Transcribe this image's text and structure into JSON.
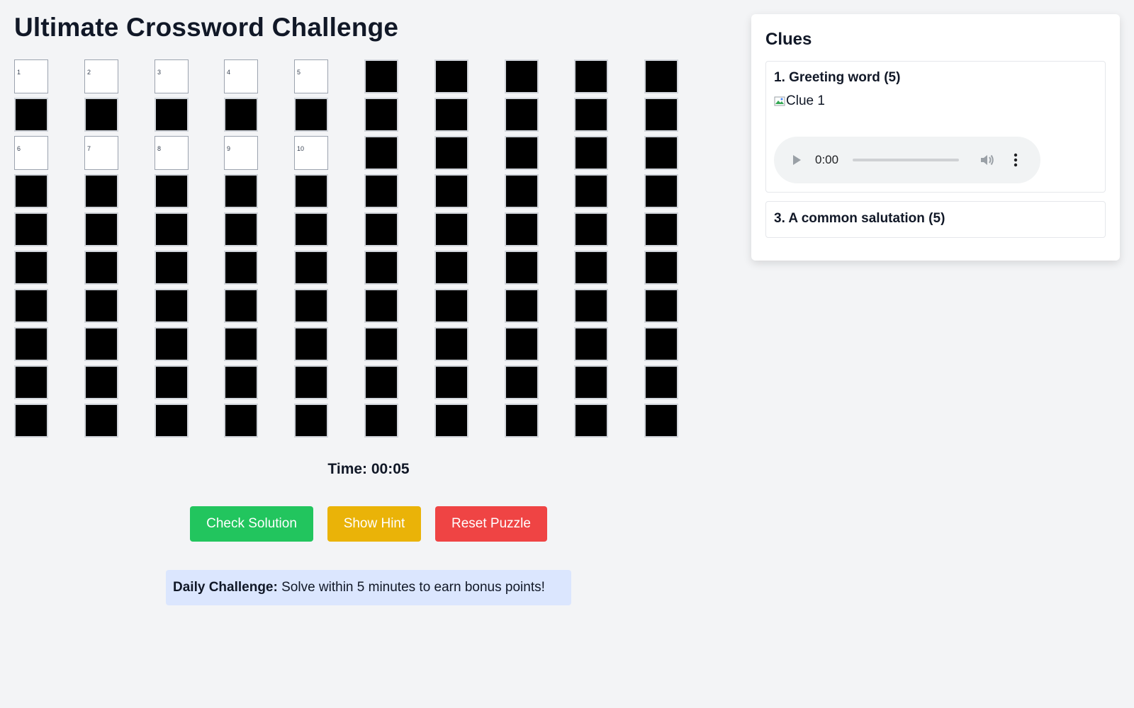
{
  "page": {
    "title": "Ultimate Crossword Challenge"
  },
  "grid": {
    "rows": 10,
    "cols": 10,
    "open_cells": [
      {
        "row": 0,
        "col": 0,
        "number": "1"
      },
      {
        "row": 0,
        "col": 1,
        "number": "2"
      },
      {
        "row": 0,
        "col": 2,
        "number": "3"
      },
      {
        "row": 0,
        "col": 3,
        "number": "4"
      },
      {
        "row": 0,
        "col": 4,
        "number": "5"
      },
      {
        "row": 2,
        "col": 0,
        "number": "6"
      },
      {
        "row": 2,
        "col": 1,
        "number": "7"
      },
      {
        "row": 2,
        "col": 2,
        "number": "8"
      },
      {
        "row": 2,
        "col": 3,
        "number": "9"
      },
      {
        "row": 2,
        "col": 4,
        "number": "10"
      }
    ],
    "open_color": "#ffffff",
    "block_color": "#000000"
  },
  "timer": {
    "text": "Time: 00:05"
  },
  "controls": {
    "check_label": "Check Solution",
    "hint_label": "Show Hint",
    "reset_label": "Reset Puzzle",
    "check_color": "#22c55e",
    "hint_color": "#eab308",
    "reset_color": "#ef4444"
  },
  "daily": {
    "label": "Daily Challenge:",
    "text": "Solve within 5 minutes to earn bonus points!",
    "background": "#dbe6fe"
  },
  "clues": {
    "heading": "Clues",
    "items": [
      {
        "title": "1. Greeting word (5)",
        "image_alt": "Clue 1",
        "audio": {
          "time": "0:00",
          "icons": [
            "play-icon",
            "volume-icon",
            "more-vertical-icon"
          ]
        }
      },
      {
        "title": "3. A common salutation (5)"
      }
    ]
  }
}
